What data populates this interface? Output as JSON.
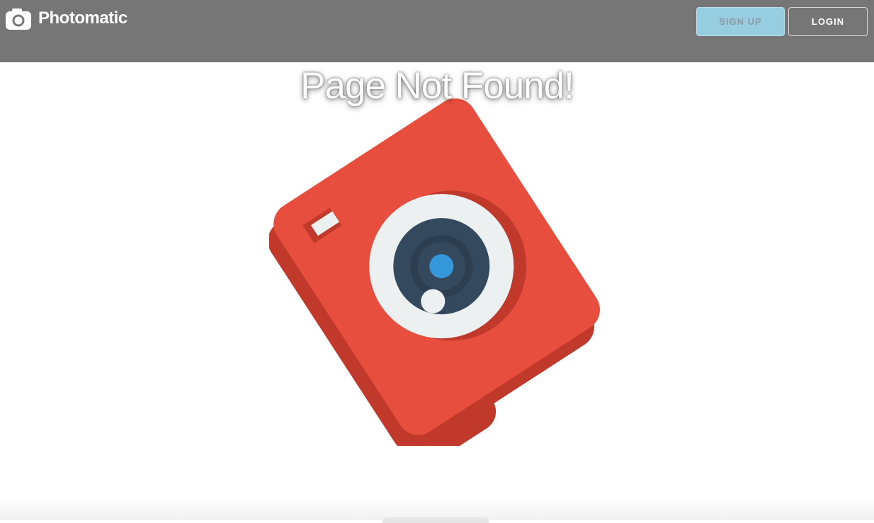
{
  "navbar": {
    "brand": {
      "icon": "camera-icon",
      "name": "Photomatic"
    },
    "signup_label": "SIGN UP",
    "login_label": "LOGIN"
  },
  "main": {
    "title": "Page Not Found!",
    "illustration": "camera-icon"
  },
  "colors": {
    "navbar_bg": "#767676",
    "signup_bg": "#96cde0",
    "camera_body": "#e84e3d",
    "camera_shadow": "#c0392b",
    "lens_ring": "#ecf0f1",
    "lens_dark": "#34495e",
    "lens_center": "#3498db"
  }
}
